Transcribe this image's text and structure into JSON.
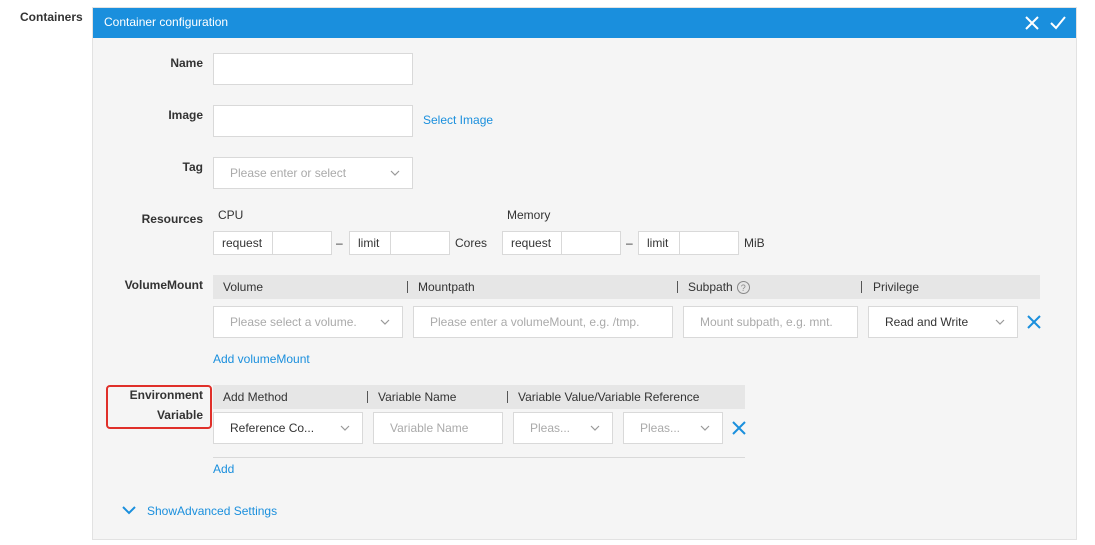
{
  "section_label": "Containers",
  "panel": {
    "title": "Container configuration",
    "close_icon": "close-icon",
    "confirm_icon": "check-icon"
  },
  "form": {
    "name_label": "Name",
    "name_value": "",
    "image_label": "Image",
    "image_value": "",
    "select_image_link": "Select Image",
    "tag_label": "Tag",
    "tag_placeholder": "Please enter or select",
    "resources_label": "Resources",
    "cpu": {
      "title": "CPU",
      "request_label": "request",
      "request_value": "",
      "dash": "–",
      "limit_label": "limit",
      "limit_value": "",
      "unit": "Cores"
    },
    "memory": {
      "title": "Memory",
      "request_label": "request",
      "request_value": "",
      "dash": "–",
      "limit_label": "limit",
      "limit_value": "",
      "unit": "MiB"
    }
  },
  "volume_mount": {
    "label": "VolumeMount",
    "headers": [
      "Volume",
      "Mountpath",
      "Subpath",
      "Privilege"
    ],
    "sep": "|",
    "help_glyph": "?",
    "row": {
      "volume_placeholder": "Please select a volume.",
      "mountpath_placeholder": "Please enter a volumeMount, e.g. /tmp.",
      "subpath_placeholder": "Mount subpath, e.g. mnt.",
      "privilege_value": "Read and Write"
    },
    "add_link": "Add volumeMount"
  },
  "env": {
    "label_line1": "Environment",
    "label_line2": "Variable",
    "headers": [
      "Add Method",
      "Variable Name",
      "Variable Value/Variable Reference"
    ],
    "sep": "|",
    "row": {
      "method_value": "Reference Co...",
      "name_placeholder": "Variable Name",
      "value_placeholder_1": "Pleas...",
      "value_placeholder_2": "Pleas..."
    },
    "add_link": "Add"
  },
  "advanced": {
    "toggle_label": "ShowAdvanced Settings"
  },
  "colors": {
    "accent": "#1a8fdd",
    "highlight_box": "#e0302a"
  }
}
